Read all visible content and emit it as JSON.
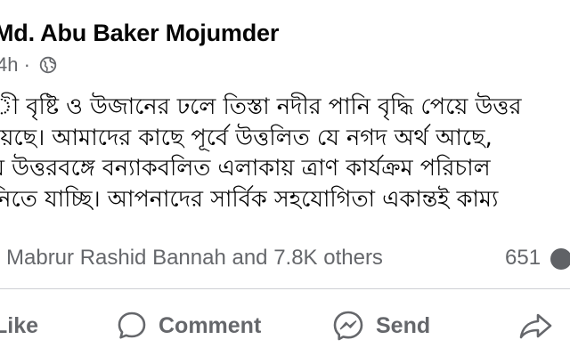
{
  "post": {
    "author": "Md. Abu Baker Mojumder",
    "time": "4h",
    "separator": "·",
    "privacy_icon": "globe-icon",
    "text_lines": [
      "ী বৃষ্টি ও উজানের ঢলে তিস্তা নদীর পানি বৃদ্ধি পেয়ে উত্তর",
      "য়েছে। আমাদের কাছে পূর্বে উত্তলিত যে নগদ অর্থ আছে,",
      "য় উত্তরবঙ্গে বন্যাকবলিত এলাকায় ত্রাণ কার্যক্রম পরিচাল",
      "নিতে যাচ্ছি। আপনাদের সার্বিক সহযোগিতা একান্তই কাম্য"
    ]
  },
  "engagement": {
    "reactions_text": "Mabrur Rashid Bannah and 7.8K others",
    "comment_count": "651"
  },
  "actions": {
    "like": "Like",
    "comment": "Comment",
    "send": "Send"
  },
  "colors": {
    "text": "#050505",
    "secondary": "#65676b",
    "divider": "#ced0d4"
  }
}
